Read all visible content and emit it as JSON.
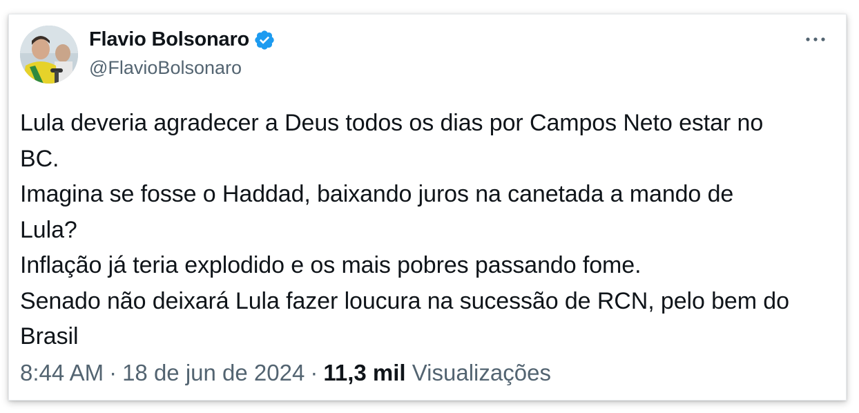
{
  "author": {
    "display_name": "Flavio Bolsonaro",
    "handle": "@FlavioBolsonaro",
    "verified_icon": "verified-badge-icon",
    "avatar": "profile-photo"
  },
  "menu_icon": "more-horizontal-icon",
  "tweet": {
    "lines": [
      "Lula deveria agradecer a Deus todos os dias por Campos Neto estar no",
      "BC.",
      "Imagina se fosse o Haddad, baixando juros na canetada a mando de",
      "Lula?",
      "Inflação já teria explodido e os mais pobres passando fome.",
      "Senado não deixará Lula fazer loucura na sucessão de RCN, pelo bem do",
      "Brasil"
    ]
  },
  "meta": {
    "time": "8:44 AM",
    "separator": "·",
    "date": "18 de jun de 2024",
    "views_count": "11,3 mil",
    "views_label": "Visualizações"
  },
  "colors": {
    "primary_text": "#0f1419",
    "secondary_text": "#536471",
    "verified_blue": "#1d9bf0"
  }
}
